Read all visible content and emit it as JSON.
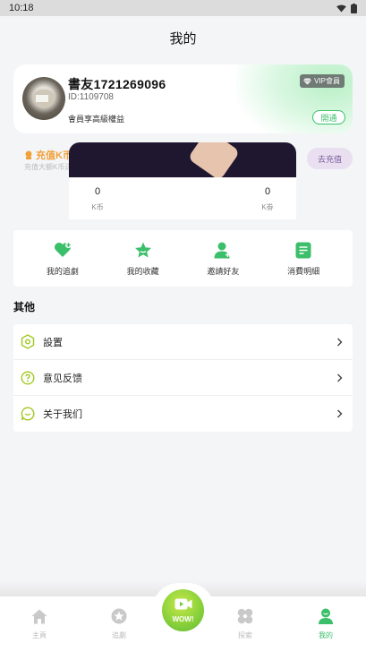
{
  "status_bar": {
    "time": "10:18"
  },
  "header": {
    "title": "我的"
  },
  "profile": {
    "name": "書友1721269096",
    "id_text": "ID:1109708",
    "member_text": "會員享高級權益",
    "vip_badge": "VIP會員",
    "open_button": "開通"
  },
  "recharge": {
    "title": "充值K币",
    "subtitle": "充值大额K币送更多K券",
    "button": "去充值"
  },
  "wallet": {
    "kcoin_value": "0",
    "kcoin_label": "K币",
    "kcoupon_value": "0",
    "kcoupon_label": "K劵"
  },
  "quick_actions": [
    {
      "label": "我的追劇",
      "icon": "heart-plus-icon"
    },
    {
      "label": "我的收藏",
      "icon": "star-icon"
    },
    {
      "label": "邀請好友",
      "icon": "add-user-icon"
    },
    {
      "label": "消費明細",
      "icon": "receipt-icon"
    }
  ],
  "other_section": {
    "title": "其他"
  },
  "menu": [
    {
      "label": "設置",
      "icon": "settings-icon"
    },
    {
      "label": "意见反馈",
      "icon": "question-icon"
    },
    {
      "label": "关于我们",
      "icon": "chat-smile-icon"
    }
  ],
  "tabs": [
    {
      "label": "主頁",
      "icon": "home-icon",
      "active": false
    },
    {
      "label": "追劇",
      "icon": "star-circle-icon",
      "active": false
    },
    {
      "label": "WOW!",
      "icon": "video-camera-icon",
      "active": false
    },
    {
      "label": "探索",
      "icon": "explore-icon",
      "active": false
    },
    {
      "label": "我的",
      "icon": "profile-icon",
      "active": true
    }
  ],
  "colors": {
    "accent_green": "#3bbf6a",
    "recharge_orange": "#f0a13a",
    "background": "#f4f5f7"
  }
}
